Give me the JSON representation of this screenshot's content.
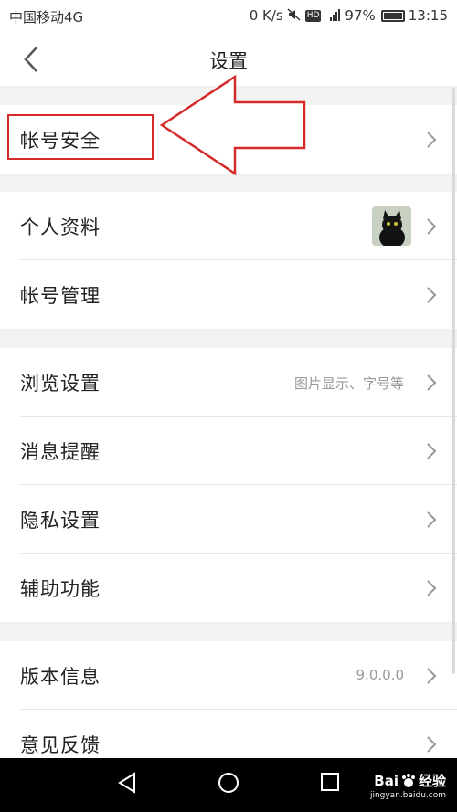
{
  "status_bar": {
    "carrier": "中国移动4G",
    "speed": "0 K/s",
    "hd": "HD",
    "network": "4G",
    "battery": "97%",
    "time": "13:15",
    "battery_level": 0.97
  },
  "nav": {
    "title": "设置"
  },
  "sections": {
    "account_security": {
      "label": "帐号安全"
    },
    "profile": {
      "label": "个人资料"
    },
    "account_manage": {
      "label": "帐号管理"
    },
    "browse_settings": {
      "label": "浏览设置",
      "value": "图片显示、字号等"
    },
    "notifications": {
      "label": "消息提醒"
    },
    "privacy": {
      "label": "隐私设置"
    },
    "accessibility": {
      "label": "辅助功能"
    },
    "version": {
      "label": "版本信息",
      "value": "9.0.0.0"
    },
    "feedback": {
      "label": "意见反馈"
    }
  },
  "watermark": {
    "brand": "Bai",
    "brand_suffix": "经验",
    "sub": "jingyan.baidu.com"
  },
  "colors": {
    "annotation": "#d42a2a",
    "background": "#f2f2f2"
  }
}
